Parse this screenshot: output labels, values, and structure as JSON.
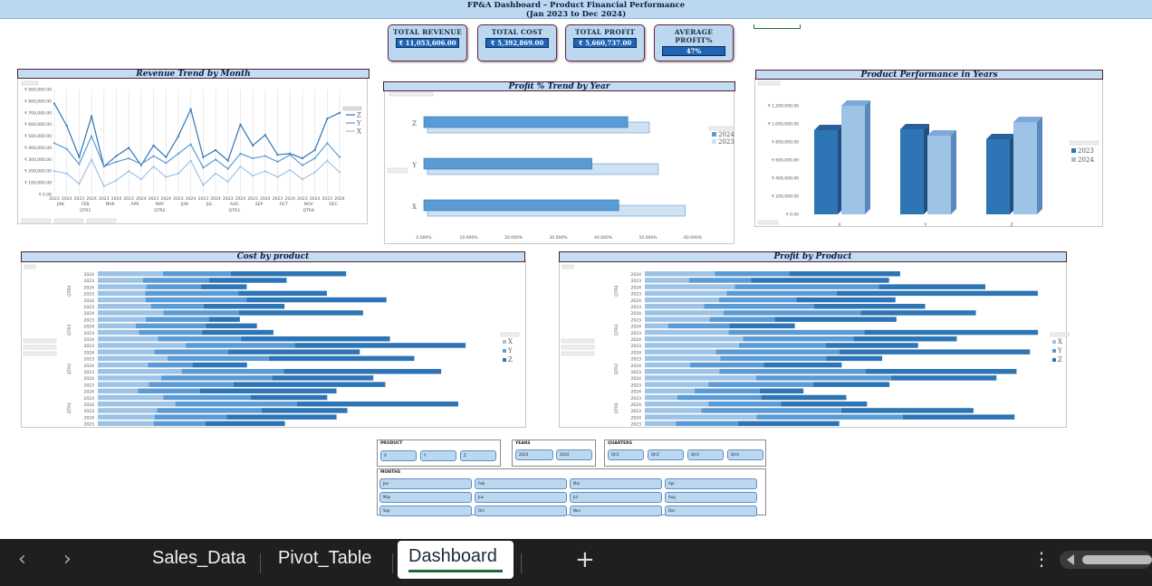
{
  "banner": {
    "line1": "FP&A Dashboard – Product Financial Performance",
    "line2": "(Jan 2023 to Dec 2024)"
  },
  "kpis": [
    {
      "label": "TOTAL REVENUE",
      "value": "₹ 11,053,606.00"
    },
    {
      "label": "TOTAL COST",
      "value": "₹ 5,392,869.00"
    },
    {
      "label": "TOTAL PROFIT",
      "value": "₹ 5,660,737.00"
    },
    {
      "label": "AVERAGE PROFIT%",
      "value": "47%"
    }
  ],
  "revenue_trend": {
    "title": "Revenue Trend by Month",
    "legend": [
      "Z",
      "Y",
      "X"
    ],
    "y_ticks": [
      "₹ 900,000.00",
      "₹ 800,000.00",
      "₹ 700,000.00",
      "₹ 600,000.00",
      "₹ 500,000.00",
      "₹ 400,000.00",
      "₹ 300,000.00",
      "₹ 200,000.00",
      "₹ 100,000.00",
      "₹ 0.00"
    ],
    "months": [
      "JAN",
      "FEB",
      "MAR",
      "APR",
      "MAY",
      "JUN",
      "JUL",
      "AUG",
      "SEP",
      "OCT",
      "NOV",
      "DEC"
    ],
    "quarters": [
      "QTR1",
      "QTR2",
      "QTR3",
      "QTR4"
    ],
    "years": [
      "2023",
      "2024"
    ]
  },
  "profit_trend": {
    "title": "Profit % Trend by Year",
    "categories": [
      "Z",
      "Y",
      "X"
    ],
    "x_ticks": [
      "0.000%",
      "10.000%",
      "20.000%",
      "30.000%",
      "40.000%",
      "50.000%",
      "60.000%"
    ],
    "legend": [
      "2024",
      "2023"
    ]
  },
  "product_perf": {
    "title": "Product Performance in Years",
    "categories": [
      "X",
      "Y",
      "Z"
    ],
    "y_ticks": [
      "₹ 1,200,000.00",
      "₹ 1,000,000.00",
      "₹ 800,000.00",
      "₹ 600,000.00",
      "₹ 400,000.00",
      "₹ 200,000.00",
      "₹ 0.00"
    ],
    "legend": [
      "2023",
      "2024"
    ]
  },
  "cost_by_product": {
    "title": "Cost by product",
    "legend": [
      "X",
      "Y",
      "Z"
    ],
    "quarters": [
      "QTR1",
      "QTR2",
      "QTR3",
      "QTR4"
    ],
    "years": [
      "2024",
      "2023"
    ]
  },
  "profit_by_product": {
    "title": "Profit by Product",
    "legend": [
      "X",
      "Y",
      "Z"
    ],
    "quarters": [
      "QTR1",
      "QTR2",
      "QTR3",
      "QTR4"
    ],
    "years": [
      "2024",
      "2023"
    ]
  },
  "slicers": {
    "product": {
      "title": "PRODUCT",
      "items": [
        "X",
        "Y",
        "Z"
      ]
    },
    "years": {
      "title": "YEARS",
      "items": [
        "2023",
        "2024"
      ]
    },
    "quarters": {
      "title": "QUARTERS",
      "items": [
        "Qtr1",
        "Qtr2",
        "Qtr3",
        "Qtr4"
      ]
    },
    "months": {
      "title": "MONTHS",
      "items": [
        "Jan",
        "Feb",
        "Mar",
        "Apr",
        "May",
        "Jun",
        "Jul",
        "Aug",
        "Sep",
        "Oct",
        "Nov",
        "Dec"
      ]
    }
  },
  "tabs": [
    "Sales_Data",
    "Pivot_Table",
    "Dashboard"
  ],
  "colors": {
    "dark": "#2e75b6",
    "mid": "#5b9bd5",
    "light": "#9dc3e6",
    "pale": "#cfe2f3",
    "header": "#bcd8f0"
  },
  "chart_data": [
    {
      "type": "line",
      "title": "Revenue Trend by Month",
      "categories": [
        "JAN 2023",
        "JAN 2024",
        "FEB 2023",
        "FEB 2024",
        "MAR 2023",
        "MAR 2024",
        "APR 2023",
        "APR 2024",
        "MAY 2023",
        "MAY 2024",
        "JUN 2023",
        "JUN 2024",
        "JUL 2023",
        "JUL 2024",
        "AUG 2023",
        "AUG 2024",
        "SEP 2023",
        "SEP 2024",
        "OCT 2023",
        "OCT 2024",
        "NOV 2023",
        "NOV 2024",
        "DEC 2023",
        "DEC 2024"
      ],
      "series": [
        {
          "name": "Z",
          "values": [
            780000,
            590000,
            320000,
            670000,
            240000,
            330000,
            400000,
            250000,
            420000,
            320000,
            500000,
            730000,
            320000,
            380000,
            290000,
            600000,
            420000,
            510000,
            340000,
            350000,
            310000,
            380000,
            650000,
            700000
          ]
        },
        {
          "name": "Y",
          "values": [
            440000,
            390000,
            260000,
            500000,
            240000,
            280000,
            310000,
            260000,
            330000,
            270000,
            350000,
            430000,
            230000,
            300000,
            220000,
            350000,
            310000,
            330000,
            280000,
            340000,
            250000,
            310000,
            440000,
            320000
          ]
        },
        {
          "name": "X",
          "values": [
            200000,
            180000,
            90000,
            300000,
            70000,
            120000,
            200000,
            130000,
            240000,
            150000,
            180000,
            290000,
            80000,
            180000,
            110000,
            240000,
            160000,
            200000,
            150000,
            210000,
            130000,
            190000,
            290000,
            190000
          ]
        }
      ],
      "ylim": [
        0,
        900000
      ]
    },
    {
      "type": "bar",
      "title": "Profit % Trend by Year",
      "categories": [
        "Z",
        "Y",
        "X"
      ],
      "series": [
        {
          "name": "2024",
          "values": [
            45.5,
            37.5,
            43.5
          ]
        },
        {
          "name": "2023",
          "values": [
            49.5,
            51.5,
            57.5
          ]
        }
      ],
      "xlim": [
        0,
        60
      ]
    },
    {
      "type": "bar",
      "title": "Product Performance in Years",
      "categories": [
        "X",
        "Y",
        "Z"
      ],
      "series": [
        {
          "name": "2023",
          "values": [
            930000,
            940000,
            830000
          ]
        },
        {
          "name": "2024",
          "values": [
            1200000,
            870000,
            1020000
          ]
        }
      ],
      "ylim": [
        0,
        1200000
      ]
    }
  ]
}
